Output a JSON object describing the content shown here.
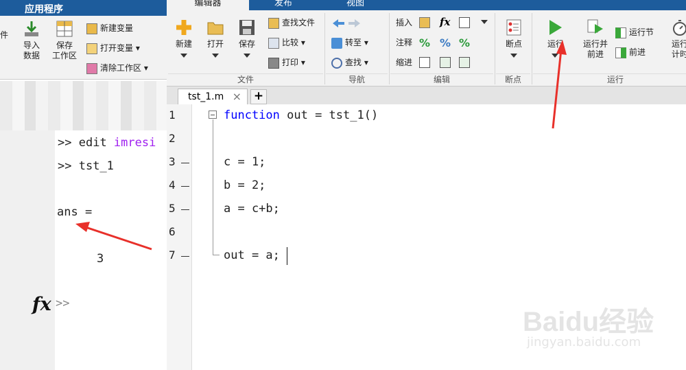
{
  "back": {
    "title": "应用程序",
    "tab_cut": "件",
    "ribbon": {
      "import_line1": "导入",
      "import_line2": "数据",
      "save_line1": "保存",
      "save_line2": "工作区",
      "new_var": "新建变量",
      "open_var": "打开变量 ▾",
      "clear_ws": "清除工作区 ▾"
    },
    "command": {
      "prompt": ">>",
      "cmd1_text": "edit ",
      "cmd1_arg": "imresi",
      "cmd2": "tst_1",
      "ans_label": "ans =",
      "ans_value": "3",
      "fx": "fx",
      "prompt_end": ">>"
    }
  },
  "editor": {
    "tabs": [
      "编辑器",
      "发布",
      "视图"
    ],
    "file": {
      "new_label": "新建",
      "open_label": "打开",
      "save_label": "保存",
      "find_files": "查找文件",
      "compare": "比较 ▾",
      "print": "打印 ▾",
      "section": "文件"
    },
    "nav": {
      "goto": "转至 ▾",
      "find": "查找 ▾",
      "section": "导航"
    },
    "edit": {
      "insert": "插入",
      "comment": "注释",
      "indent": "缩进",
      "fx": "fx",
      "section": "编辑"
    },
    "bp": {
      "label": "断点",
      "section": "断点"
    },
    "run": {
      "run_label": "运行",
      "run_advance_line1": "运行并",
      "run_advance_line2": "前进",
      "run_section": "运行节",
      "advance": "前进",
      "run_time_line1": "运行",
      "run_time_line2": "计时",
      "section": "运行"
    },
    "doc_tab": {
      "name": "tst_1.m",
      "close": "×",
      "add": "+"
    },
    "lines": [
      {
        "num": "1",
        "kw": "function",
        "rest": " out = tst_1()"
      },
      {
        "num": "2",
        "kw": "",
        "rest": ""
      },
      {
        "num": "3",
        "kw": "",
        "rest": "c = 1;"
      },
      {
        "num": "4",
        "kw": "",
        "rest": "b = 2;"
      },
      {
        "num": "5",
        "kw": "",
        "rest": "a = c+b;"
      },
      {
        "num": "6",
        "kw": "",
        "rest": ""
      },
      {
        "num": "7",
        "kw": "",
        "rest": "out = a;"
      }
    ]
  },
  "watermark": {
    "brand": "Bai",
    "brand2": "du",
    "cn": "经验",
    "url": "jingyan.baidu.com"
  },
  "colors": {
    "title_blue": "#1d5c9c",
    "keyword_blue": "#0000ff",
    "arg_purple": "#a020f0",
    "annotation_red": "#e8302a",
    "run_green": "#3aa83a"
  }
}
